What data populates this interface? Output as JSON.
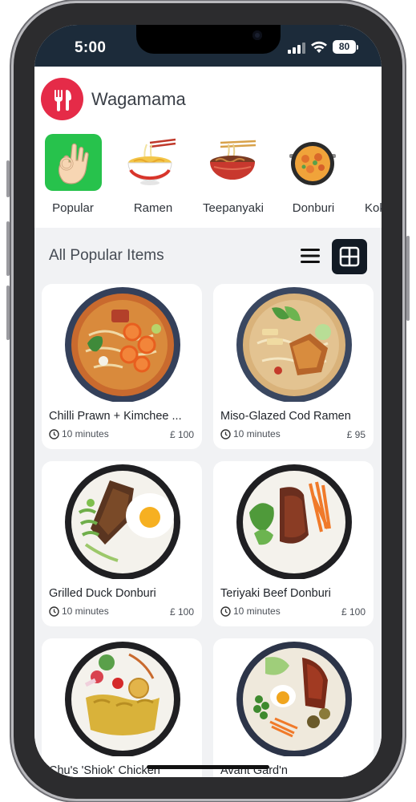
{
  "status_bar": {
    "time": "5:00",
    "battery": "80"
  },
  "header": {
    "app_name": "Wagamama",
    "logo_icon": "fork-knife-icon"
  },
  "categories": [
    {
      "label": "Popular",
      "icon": "ok-hand-icon",
      "selected": true
    },
    {
      "label": "Ramen",
      "icon": "ramen-bowl-icon",
      "selected": false
    },
    {
      "label": "Teepanyaki",
      "icon": "noodle-bowl-icon",
      "selected": false
    },
    {
      "label": "Donburi",
      "icon": "donburi-pan-icon",
      "selected": false
    },
    {
      "label": "Kok",
      "icon": "partial-icon",
      "selected": false
    }
  ],
  "section": {
    "title": "All Popular Items",
    "list_view_icon": "list-view-icon",
    "grid_view_icon": "grid-view-icon"
  },
  "items": [
    {
      "name": "Chilli Prawn + Kimchee ...",
      "time": "10 minutes",
      "price": "£ 100"
    },
    {
      "name": "Miso-Glazed Cod Ramen",
      "time": "10 minutes",
      "price": "£ 95"
    },
    {
      "name": "Grilled Duck Donburi",
      "time": "10 minutes",
      "price": "£ 100"
    },
    {
      "name": "Teriyaki Beef Donburi",
      "time": "10 minutes",
      "price": "£ 100"
    },
    {
      "name": "Chu's 'Shiok' Chicken",
      "time": "",
      "price": ""
    },
    {
      "name": "Avant Gard'n",
      "time": "",
      "price": ""
    }
  ],
  "colors": {
    "brand": "#e52b48",
    "selected_category": "#27c24c",
    "status_bar": "#1c2b3a",
    "background": "#f1f2f4"
  }
}
